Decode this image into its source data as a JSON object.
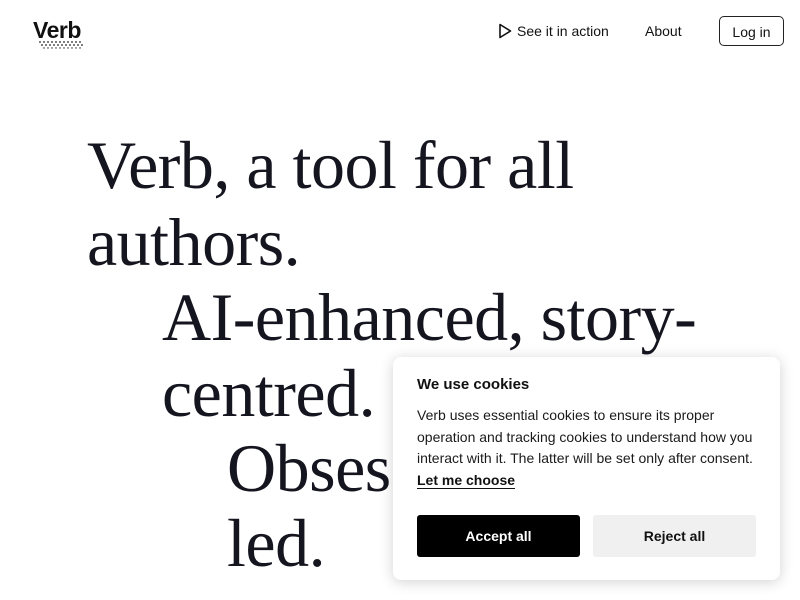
{
  "header": {
    "logo_text": "Verb",
    "nav": {
      "see_in_action": "See it in action",
      "about": "About",
      "login": "Log in"
    }
  },
  "hero": {
    "lines": [
      "Verb, a tool for all",
      "authors.",
      "AI-enhanced, story-",
      "centred.",
      "Obses",
      "led."
    ]
  },
  "cookie_banner": {
    "title": "We use cookies",
    "body": "Verb uses essential cookies to ensure its proper operation and tracking cookies to understand how you interact with it. The latter will be set only after consent.",
    "link": "Let me choose",
    "accept": "Accept all",
    "reject": "Reject all"
  },
  "icons": {
    "play": "play-icon"
  },
  "colors": {
    "text": "#15151f",
    "accept_bg": "#000000",
    "reject_bg": "#f0f0f0"
  }
}
